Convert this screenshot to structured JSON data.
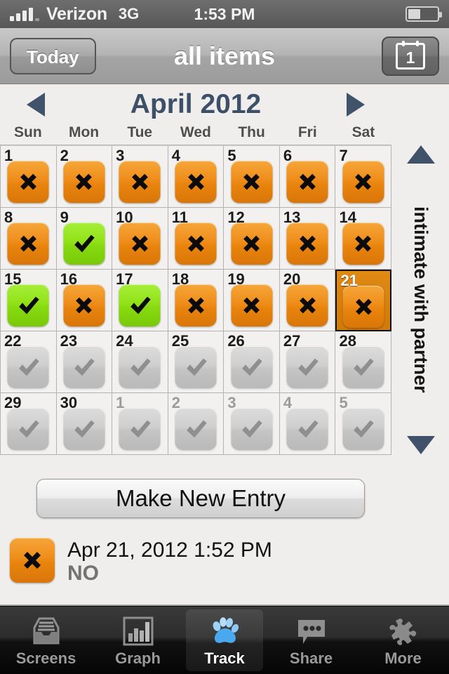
{
  "status_bar": {
    "carrier": "Verizon",
    "network": "3G",
    "time": "1:53 PM",
    "signal_icon": "signal-bars-icon",
    "battery_icon": "battery-icon",
    "battery_level_pct": 38
  },
  "nav_bar": {
    "back_label": "Today",
    "title": "all items",
    "right_button_label": "1",
    "right_button_icon": "calendar-icon"
  },
  "calendar": {
    "prev_icon": "triangle-left-icon",
    "next_icon": "triangle-right-icon",
    "month_label": "April 2012",
    "weekdays": [
      "Sun",
      "Mon",
      "Tue",
      "Wed",
      "Thu",
      "Fri",
      "Sat"
    ],
    "weeks": [
      [
        {
          "day": "1",
          "state": "no",
          "current_month": true,
          "selected": false
        },
        {
          "day": "2",
          "state": "no",
          "current_month": true,
          "selected": false
        },
        {
          "day": "3",
          "state": "no",
          "current_month": true,
          "selected": false
        },
        {
          "day": "4",
          "state": "no",
          "current_month": true,
          "selected": false
        },
        {
          "day": "5",
          "state": "no",
          "current_month": true,
          "selected": false
        },
        {
          "day": "6",
          "state": "no",
          "current_month": true,
          "selected": false
        },
        {
          "day": "7",
          "state": "no",
          "current_month": true,
          "selected": false
        }
      ],
      [
        {
          "day": "8",
          "state": "no",
          "current_month": true,
          "selected": false
        },
        {
          "day": "9",
          "state": "yes",
          "current_month": true,
          "selected": false
        },
        {
          "day": "10",
          "state": "no",
          "current_month": true,
          "selected": false
        },
        {
          "day": "11",
          "state": "no",
          "current_month": true,
          "selected": false
        },
        {
          "day": "12",
          "state": "no",
          "current_month": true,
          "selected": false
        },
        {
          "day": "13",
          "state": "no",
          "current_month": true,
          "selected": false
        },
        {
          "day": "14",
          "state": "no",
          "current_month": true,
          "selected": false
        }
      ],
      [
        {
          "day": "15",
          "state": "yes",
          "current_month": true,
          "selected": false
        },
        {
          "day": "16",
          "state": "no",
          "current_month": true,
          "selected": false
        },
        {
          "day": "17",
          "state": "yes",
          "current_month": true,
          "selected": false
        },
        {
          "day": "18",
          "state": "no",
          "current_month": true,
          "selected": false
        },
        {
          "day": "19",
          "state": "no",
          "current_month": true,
          "selected": false
        },
        {
          "day": "20",
          "state": "no",
          "current_month": true,
          "selected": false
        },
        {
          "day": "21",
          "state": "no",
          "current_month": true,
          "selected": true
        }
      ],
      [
        {
          "day": "22",
          "state": "none",
          "current_month": true,
          "selected": false
        },
        {
          "day": "23",
          "state": "none",
          "current_month": true,
          "selected": false
        },
        {
          "day": "24",
          "state": "none",
          "current_month": true,
          "selected": false
        },
        {
          "day": "25",
          "state": "none",
          "current_month": true,
          "selected": false
        },
        {
          "day": "26",
          "state": "none",
          "current_month": true,
          "selected": false
        },
        {
          "day": "27",
          "state": "none",
          "current_month": true,
          "selected": false
        },
        {
          "day": "28",
          "state": "none",
          "current_month": true,
          "selected": false
        }
      ],
      [
        {
          "day": "29",
          "state": "none",
          "current_month": true,
          "selected": false
        },
        {
          "day": "30",
          "state": "none",
          "current_month": true,
          "selected": false
        },
        {
          "day": "1",
          "state": "none",
          "current_month": false,
          "selected": false
        },
        {
          "day": "2",
          "state": "none",
          "current_month": false,
          "selected": false
        },
        {
          "day": "3",
          "state": "none",
          "current_month": false,
          "selected": false
        },
        {
          "day": "4",
          "state": "none",
          "current_month": false,
          "selected": false
        },
        {
          "day": "5",
          "state": "none",
          "current_month": false,
          "selected": false
        }
      ]
    ]
  },
  "side_scroller": {
    "up_icon": "triangle-up-icon",
    "down_icon": "triangle-down-icon",
    "tracker_name": "intimate with partner"
  },
  "new_entry_button": {
    "label": "Make New Entry"
  },
  "recent_entry": {
    "icon": "x-mark-icon",
    "date": "Apr 21, 2012 1:52 PM",
    "value": "NO"
  },
  "tab_bar": {
    "tabs": [
      {
        "label": "Screens",
        "icon": "inbox-tray-icon",
        "active": false
      },
      {
        "label": "Graph",
        "icon": "bar-chart-icon",
        "active": false
      },
      {
        "label": "Track",
        "icon": "paw-print-icon",
        "active": true
      },
      {
        "label": "Share",
        "icon": "speech-bubble-icon",
        "active": false
      },
      {
        "label": "More",
        "icon": "puzzle-piece-icon",
        "active": false
      }
    ]
  },
  "colors": {
    "no_orange": "#ef8f1c",
    "yes_green": "#93e319",
    "none_gray": "#c4c4c4",
    "selected_bg": "#d9800e",
    "accent_navy": "#3e5068",
    "active_tab_blue": "#4aa8ef"
  }
}
